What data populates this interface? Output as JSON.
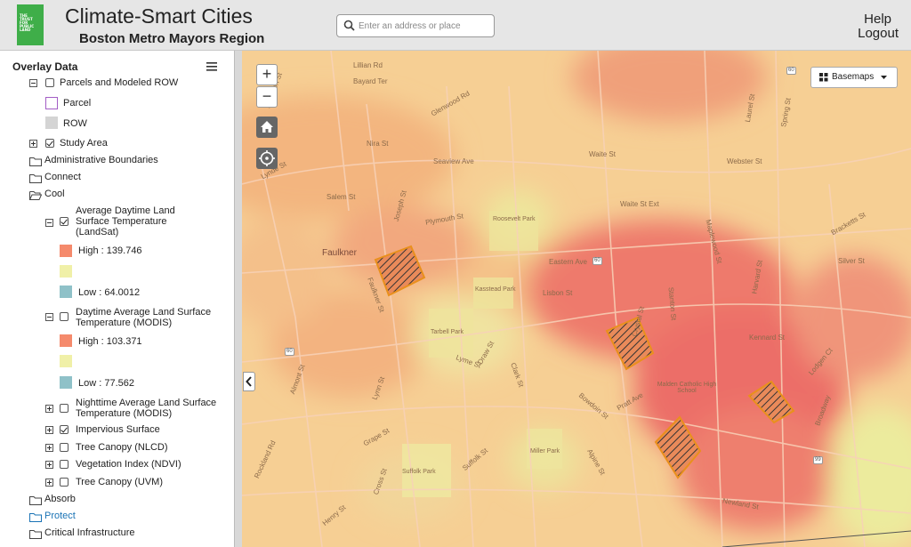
{
  "header": {
    "logo_text": [
      "THE",
      "TRUST",
      "FOR",
      "PUBLIC",
      "LAND"
    ],
    "title": "Climate-Smart Cities",
    "subtitle": "Boston Metro Mayors Region",
    "search_placeholder": "Enter an address or place",
    "help": "Help",
    "logout": "Logout"
  },
  "sidebar": {
    "heading": "Overlay Data",
    "tree": {
      "parcels": "Parcels and Modeled ROW",
      "parcel": "Parcel",
      "row": "ROW",
      "study_area": "Study Area",
      "admin": "Administrative Boundaries",
      "connect": "Connect",
      "cool": "Cool",
      "avg_day": "Average Daytime Land Surface Temperature (LandSat)",
      "avg_day_high": "High : 139.746",
      "avg_day_low": "Low : 64.0012",
      "modis_day": "Daytime Average Land Surface Temperature (MODIS)",
      "modis_day_high": "High : 103.371",
      "modis_day_low": "Low : 77.562",
      "modis_night": "Nighttime Average Land Surface Temperature (MODIS)",
      "impervious": "Impervious Surface",
      "canopy_nlcd": "Tree Canopy (NLCD)",
      "ndvi": "Vegetation Index (NDVI)",
      "canopy_uvm": "Tree Canopy (UVM)",
      "absorb": "Absorb",
      "protect": "Protect",
      "critical": "Critical Infrastructure",
      "checked": {
        "parcels": false,
        "study_area": true,
        "avg_day": true,
        "modis_day": false,
        "modis_night": false,
        "impervious": true,
        "canopy_nlcd": false,
        "ndvi": false,
        "canopy_uvm": false
      }
    }
  },
  "map": {
    "basemaps_label": "Basemaps",
    "zoom_in": "+",
    "zoom_out": "−",
    "places": {
      "faulkner": "Faulkner",
      "roosevelt": "Roosevelt Park",
      "kasstead": "Kasstead Park",
      "tarbell": "Tarbell Park",
      "malden_catholic": "Malden Catholic High School",
      "suffolk_park": "Suffolk Park",
      "miller_park": "Miller Park"
    },
    "streets": {
      "lillian": "Lillian Rd",
      "bayard": "Bayard Ter",
      "glenwood": "Glenwood Rd",
      "nira": "Nira St",
      "seaview": "Seaview Ave",
      "lynde": "Lynde St",
      "salem": "Salem St",
      "joseph": "Joseph St",
      "plymouth": "Plymouth St",
      "waite": "Waite St",
      "waite_ext": "Waite St Ext",
      "webster": "Webster St",
      "eastern": "Eastern Ave",
      "faulkner_st": "Faulkner St",
      "lisbon": "Lisbon St",
      "crystal": "Crystal St",
      "lyme": "Lyme St",
      "draw": "Draw St",
      "almont": "Almont St",
      "lynn": "Lynn St",
      "clark": "Clark St",
      "bowdoin": "Bowdoin St",
      "pratt": "Pratt Ave",
      "suffolk": "Suffolk St",
      "rockland": "Rockland Rd",
      "alpine": "Alpine St",
      "newland": "Newland St",
      "broadway": "Broadway",
      "lodgen": "Lodgen Ct",
      "silver": "Silver St",
      "kennard": "Kennard St",
      "harvard": "Harvard St",
      "maplewood": "Maplewood St",
      "stanton": "Stanton St",
      "laurel": "Laurel St",
      "spring": "Spring St",
      "grape": "Grape St",
      "cross": "Cross St",
      "henry": "Henry St",
      "brazilian": "Bracketts St",
      "appleton": "Appleton St"
    },
    "route_shields": [
      "60",
      "60",
      "99",
      "60"
    ]
  },
  "colors": {
    "header_bg": "#e6e6e6",
    "logo_green": "#3fae49",
    "link_blue": "#1a73b5",
    "heat_high": "#ef6f66",
    "heat_mid": "#f5d08e",
    "heat_low": "#e9e79a",
    "parcel_purple": "#a35ec5"
  }
}
